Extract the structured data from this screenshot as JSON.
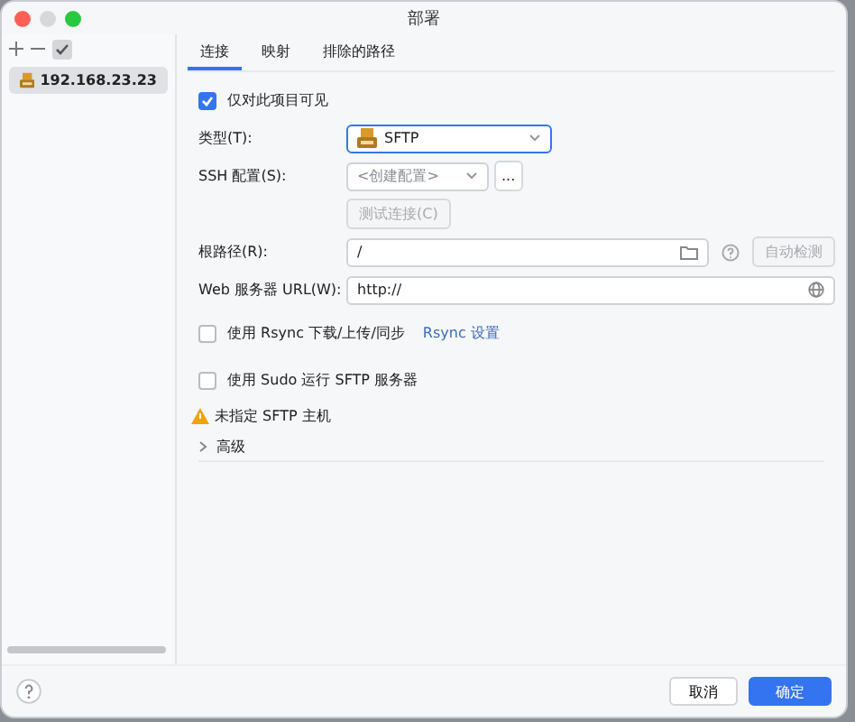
{
  "window": {
    "title": "部署"
  },
  "sidebar": {
    "items": [
      {
        "label": "192.168.23.23",
        "selected": true
      }
    ]
  },
  "tabs": [
    {
      "label": "连接",
      "selected": true
    },
    {
      "label": "映射",
      "selected": false
    },
    {
      "label": "排除的路径",
      "selected": false
    }
  ],
  "visible_only": {
    "label": "仅对此项目可见",
    "checked": true
  },
  "type": {
    "label": "类型(T):",
    "value": "SFTP"
  },
  "ssh_config": {
    "label": "SSH 配置(S):",
    "value": "<创建配置>",
    "more_button": "..."
  },
  "test_button": {
    "label": "测试连接(C)",
    "disabled": true
  },
  "root_path": {
    "label": "根路径(R):",
    "value": "/",
    "autodetect_button": "自动检测"
  },
  "web_url": {
    "label": "Web 服务器 URL(W):",
    "value": "http://"
  },
  "rsync": {
    "label": "使用 Rsync 下载/上传/同步",
    "checked": false,
    "link": "Rsync 设置"
  },
  "sudo": {
    "label": "使用 Sudo 运行 SFTP 服务器",
    "checked": false
  },
  "warning": {
    "text": "未指定 SFTP 主机"
  },
  "advanced": {
    "label": "高级",
    "expanded": false
  },
  "buttons": [
    {
      "label": "取消",
      "kind": "secondary"
    },
    {
      "label": "确定",
      "kind": "primary"
    }
  ]
}
